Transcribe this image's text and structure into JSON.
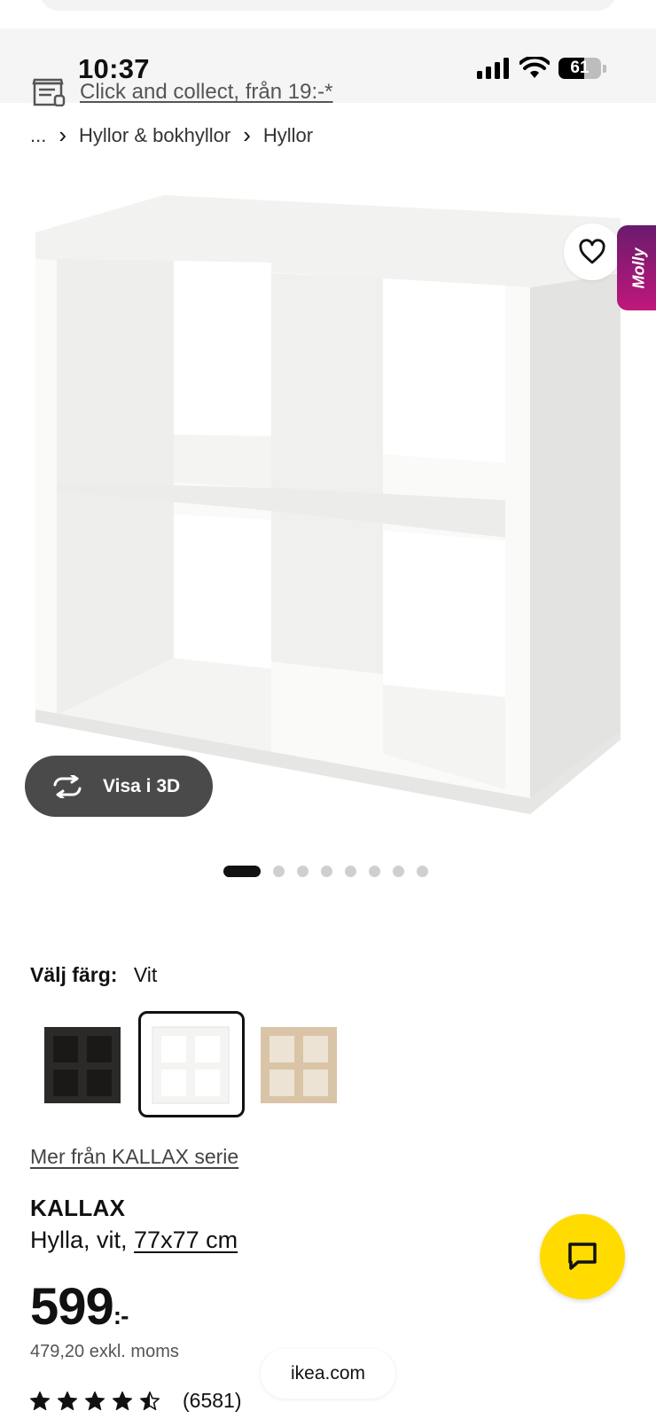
{
  "status_bar": {
    "time": "10:37",
    "battery": "61",
    "battery_level": 0.61
  },
  "collect": {
    "label": "Click and collect, från 19:-*",
    "icon": "store-icon"
  },
  "breadcrumb": {
    "ellipsis": "...",
    "items": [
      "Hyllor & bokhyllor",
      "Hyllor"
    ]
  },
  "hero": {
    "molly_label": "Molly",
    "view3d_label": "Visa i 3D",
    "carousel": {
      "total": 8,
      "active": 0
    }
  },
  "color": {
    "label": "Välj färg:",
    "selected": "Vit",
    "swatches": [
      {
        "name": "black-brown",
        "color": "#2b2a29"
      },
      {
        "name": "white",
        "color": "#f4f4f2"
      },
      {
        "name": "white-stained-oak",
        "color": "#d9c4a7"
      }
    ]
  },
  "series_link": "Mer från KALLAX serie",
  "product": {
    "name": "KALLAX",
    "desc_prefix": "Hylla, vit, ",
    "size": "77x77 cm",
    "price": "599",
    "price_suffix": ":-",
    "ex_vat": "479,20 exkl. moms",
    "rating": 4.5,
    "reviews": "(6581)"
  },
  "footer": {
    "url": "ikea.com"
  },
  "colors": {
    "accent_yellow": "#ffdb00",
    "molly_gradient": [
      "#6a1a6e",
      "#c0187a"
    ]
  }
}
